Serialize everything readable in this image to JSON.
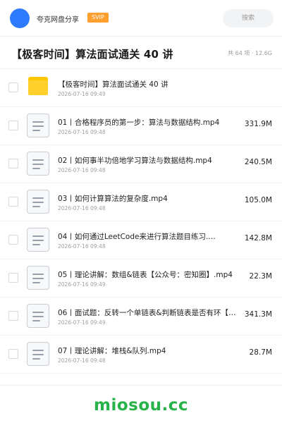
{
  "header": {
    "share_label": "夸克网盘分享",
    "svip_badge": "SVIP",
    "search_placeholder": "搜索"
  },
  "title_bar": {
    "title": "【极客时间】算法面试通关 40 讲",
    "count_info": "共 64 项 · 12.6G"
  },
  "files": [
    {
      "name": "【极客时间】算法面试通关 40 讲",
      "date": "2026-07-16 09:49",
      "size": "",
      "type": "folder"
    },
    {
      "name": "01丨合格程序员的第一步：算法与数据结构.mp4",
      "date": "2026-07-16 09:48",
      "size": "331.9M",
      "type": "video"
    },
    {
      "name": "02丨如何事半功倍地学习算法与数据结构.mp4",
      "date": "2026-07-16 09:48",
      "size": "240.5M",
      "type": "video"
    },
    {
      "name": "03丨如何计算算法的复杂度.mp4",
      "date": "2026-07-16 09:48",
      "size": "105.0M",
      "type": "video"
    },
    {
      "name": "04丨如何通过LeetCode来进行算法题目练习.…",
      "date": "2026-07-16 09:48",
      "size": "142.8M",
      "type": "video"
    },
    {
      "name": "05丨理论讲解：数组&链表【公众号：密知圈】.mp4",
      "date": "2026-07-16 09:49",
      "size": "22.3M",
      "type": "video"
    },
    {
      "name": "06丨面试题：反转一个单链表&判断链表是否有环【公…",
      "date": "2026-07-16 09:49",
      "size": "341.3M",
      "type": "video"
    },
    {
      "name": "07丨理论讲解：堆栈&队列.mp4",
      "date": "2026-07-16 09:48",
      "size": "28.7M",
      "type": "video"
    }
  ],
  "watermark": "miosou.cc",
  "colors": {
    "accent_blue": "#2f7bff",
    "svip_orange": "#ff9f2e",
    "folder_yellow": "#ffcf2b",
    "watermark_green": "#27b24a"
  }
}
